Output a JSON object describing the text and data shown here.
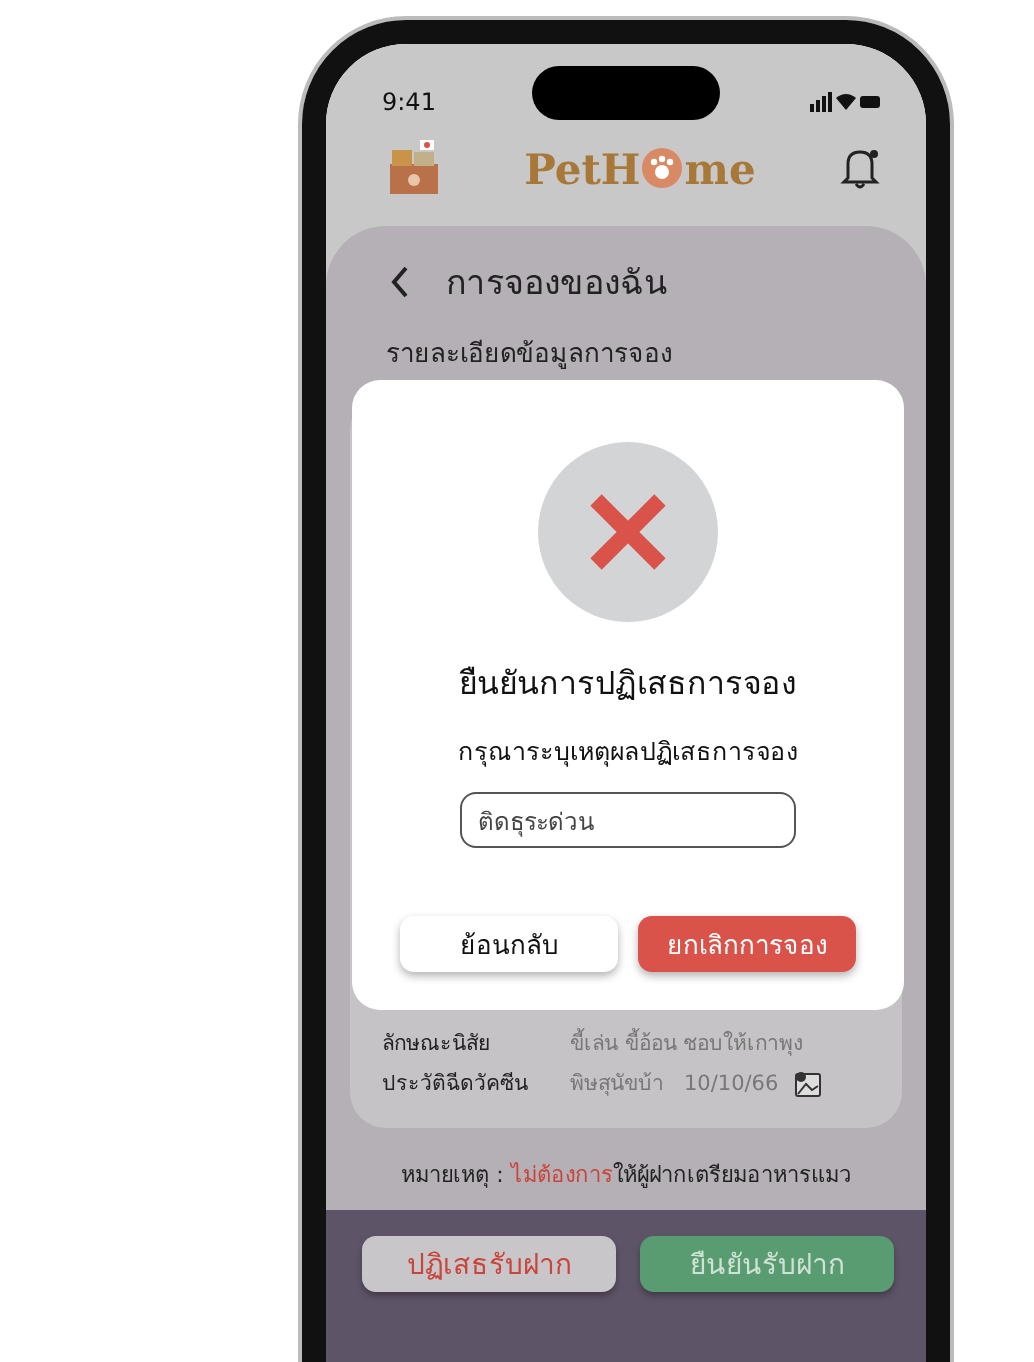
{
  "status_bar": {
    "time": "9:41"
  },
  "header": {
    "logo": [
      "PetH",
      "me"
    ]
  },
  "page": {
    "title": "การจองของฉัน",
    "section": "รายละเอียดข้อมูลการจอง"
  },
  "details": [
    {
      "label": "ลักษณะนิสัย",
      "value": "ขี้เล่น ขี้อ้อน ชอบให้เกาพุง",
      "attachment": false
    },
    {
      "label": "ประวัติฉีดวัคซีน",
      "value": "พิษสุนัขบ้า",
      "date": "10/10/66",
      "attachment": true
    }
  ],
  "note": {
    "label": "หมายเหตุ :",
    "highlight": "ไม่ต้องการ",
    "text": "ให้ผู้ฝากเตรียมอาหารแมว"
  },
  "actions": {
    "reject": "ปฏิเสธรับฝาก",
    "confirm": "ยืนยันรับฝาก"
  },
  "dialog": {
    "title": "ยืนยันการปฏิเสธการจอง",
    "prompt": "กรุณาระบุเหตุผลปฏิเสธการจอง",
    "reason": "ติดธุระด่วน",
    "back": "ย้อนกลับ",
    "cancel": "ยกเลิกการจอง"
  }
}
